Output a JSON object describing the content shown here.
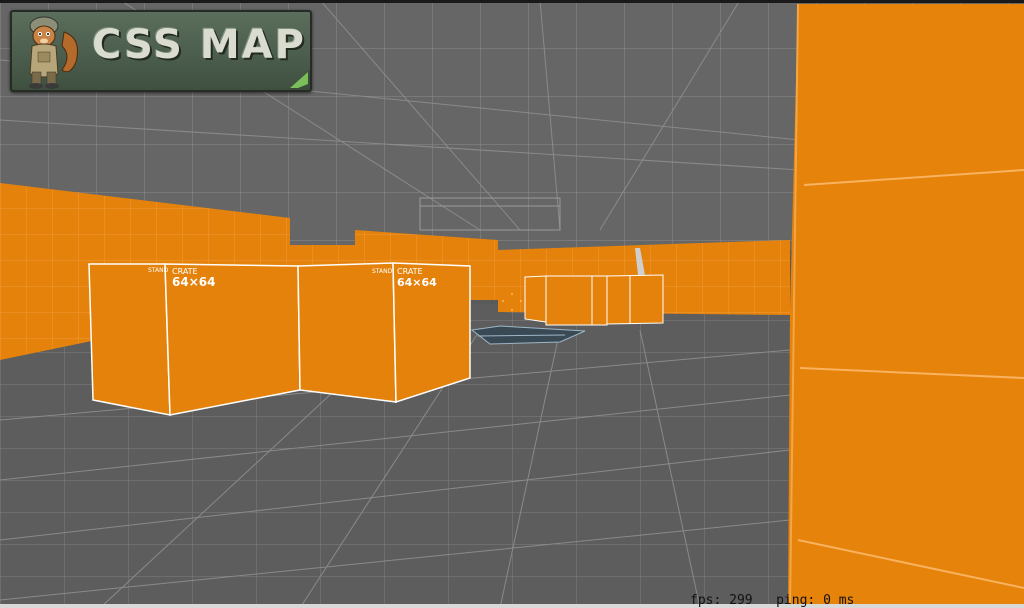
{
  "logo": {
    "text": "CSS MAP",
    "mascot_icon": "squirrel-soldier-mascot"
  },
  "crates": [
    {
      "label_small": "STAND",
      "label_title": "CRATE",
      "label_size": "64×64"
    },
    {
      "label_small": "STAND",
      "label_title": "CRATE",
      "label_size": "64×64"
    }
  ],
  "hud": {
    "fps_label": "fps:",
    "fps_value": "299",
    "ping_label": "ping:",
    "ping_value": "0 ms"
  },
  "colors": {
    "wall_orange": "#e5820b",
    "floor_gray": "#5d5d5d",
    "grid_line": "#8a8a8a",
    "logo_green": "#4e604f",
    "logo_text": "#d9dccf"
  }
}
